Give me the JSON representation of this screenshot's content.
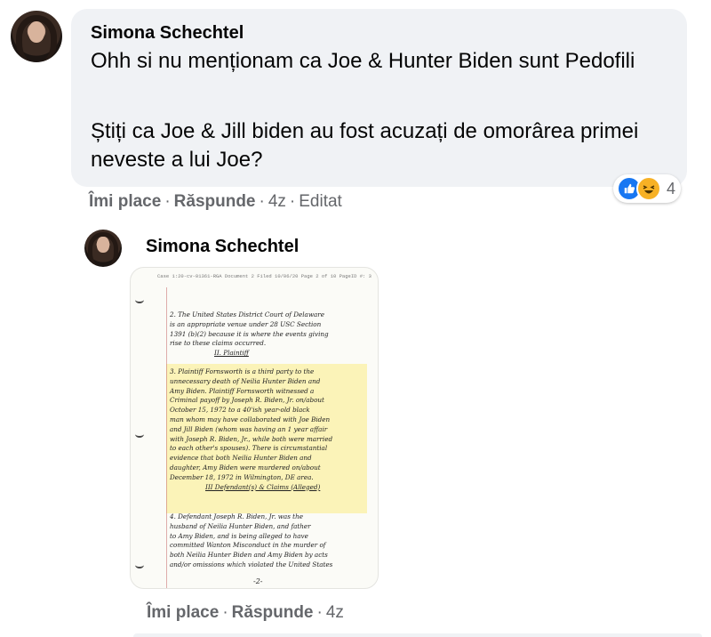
{
  "comment": {
    "author": "Simona Schechtel",
    "paragraph1": "Ohh si nu menționam ca Joe & Hunter Biden sunt Pedofili",
    "paragraph2": "Știți ca Joe & Jill biden au fost acuzați de omorârea primei neveste a lui Joe?",
    "actions": {
      "like": "Îmi place",
      "reply": "Răspunde",
      "time": "4z",
      "edited": "Editat"
    },
    "reactions": {
      "icons": [
        "like-icon",
        "haha-icon"
      ],
      "count": "4"
    }
  },
  "reply": {
    "author": "Simona Schechtel",
    "attachment": {
      "header": "Case 1:20-cv-01361-RGA   Document 2   Filed 10/06/20   Page 2 of 10 PageID #: 3",
      "lines_p2": [
        "2. The United States District Court of Delaware",
        "is an appropriate venue under 28 USC Section",
        "1391 (b)(2) because it is where the events giving",
        "rise to these claims occurred."
      ],
      "section_plaintiff": "II. Plaintiff",
      "lines_p3": [
        "3. Plaintiff Fornsworth is a third party to the",
        "unnecessary death of Neilia Hunter Biden and",
        "Amy Biden. Plaintiff Fornsworth witnessed a",
        "Criminal payoff by Joseph R. Biden, Jr. on/about",
        "October 15, 1972 to a 40'ish year-old black",
        "man whom may have collaborated with Joe Biden",
        "and Jill Biden (whom was having an 1 year affair",
        "with Joseph R. Biden, Jr., while both were married",
        "to each other's spouses). There is circumstantial",
        "evidence that both Neilia Hunter Biden and",
        "daughter, Amy Biden were murdered on/about",
        "December 18, 1972 in Wilmington, DE area."
      ],
      "section_defendants": "III Defendant(s) & Claims (Alleged)",
      "lines_p4": [
        "4. Defendant Joseph R. Biden, Jr. was the",
        "husband of Neilia Hunter Biden, and father",
        "to Amy Biden, and is being alleged to have",
        "committed Wanton Misconduct in the murder of",
        "both Neilia Hunter Biden and Amy Biden by acts",
        "and/or omissions which violated the United States"
      ],
      "page_number": "-2-"
    },
    "actions": {
      "like": "Îmi place",
      "reply": "Răspunde",
      "time": "4z"
    }
  },
  "colors": {
    "bubble": "#f0f2f5",
    "meta_text": "#65676b",
    "like_blue": "#1877f2",
    "haha_yellow": "#f7b125",
    "highlight": "#fbf3b8"
  }
}
